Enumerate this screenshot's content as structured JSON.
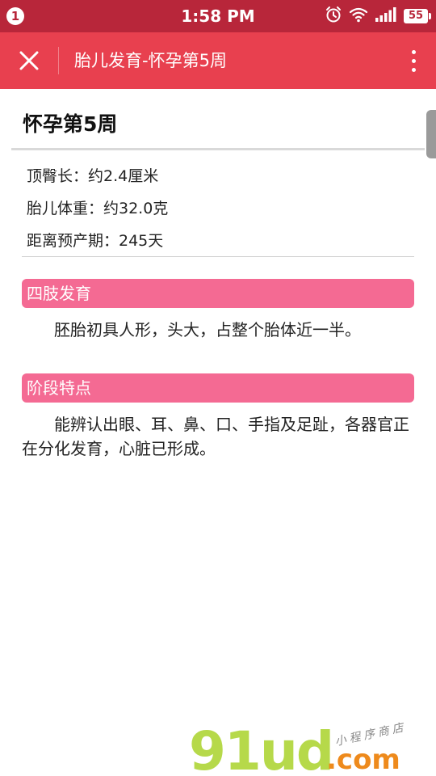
{
  "status_bar": {
    "notification_count": "1",
    "time": "1:58 PM",
    "battery": "55",
    "icons": [
      "alarm-icon",
      "wifi-icon",
      "signal-icon"
    ]
  },
  "toolbar": {
    "title": "胎儿发育-怀孕第5周",
    "close_icon": "close-icon",
    "menu_icon": "more-vertical-icon"
  },
  "page": {
    "title": "怀孕第5周",
    "stats": [
      {
        "text": "顶臀长：约2.4厘米"
      },
      {
        "text": "胎儿体重：约32.0克"
      },
      {
        "text": "距离预产期：245天"
      }
    ],
    "sections": [
      {
        "heading": "四肢发育",
        "body": "胚胎初具人形，头大，占整个胎体近一半。"
      },
      {
        "heading": "阶段特点",
        "body": "能辨认出眼、耳、鼻、口、手指及足趾，各器官正在分化发育，心脏已形成。"
      }
    ]
  },
  "watermark": {
    "digits": "91ud",
    "domain": ".com",
    "tagline": "小程序商店"
  },
  "colors": {
    "status_bar": "#b8263a",
    "toolbar": "#e8404f",
    "section_header": "#f46a93",
    "watermark_green": "#b6d94a",
    "watermark_orange": "#ee8a1c"
  }
}
